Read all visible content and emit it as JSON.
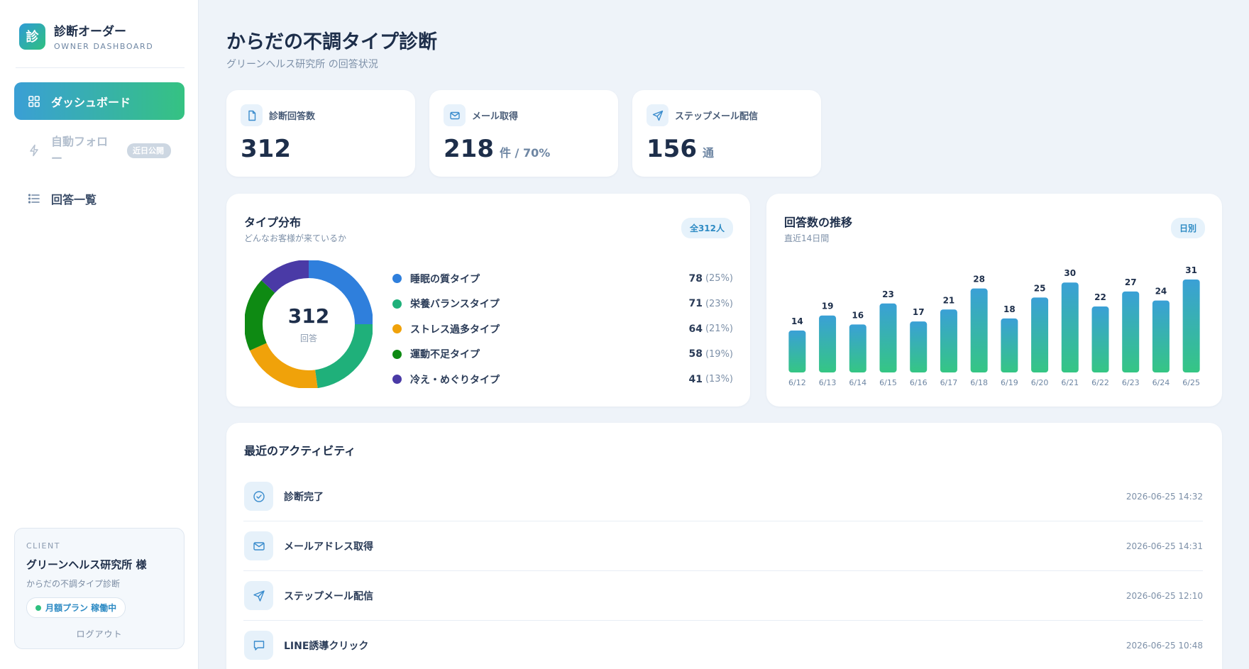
{
  "sidebar": {
    "logo_char": "診",
    "brand_title": "診断オーダー",
    "brand_sub": "OWNER DASHBOARD",
    "nav": [
      {
        "label": "ダッシュボード",
        "icon": "grid-icon",
        "state": "active"
      },
      {
        "label": "自動フォロー",
        "icon": "lightning-icon",
        "state": "disabled",
        "badge": "近日公開"
      },
      {
        "label": "回答一覧",
        "icon": "list-icon",
        "state": "default"
      }
    ],
    "client": {
      "kicker": "CLIENT",
      "name": "グリーンヘルス研究所 様",
      "diagnosis": "からだの不調タイプ診断",
      "plan": "月額プラン 稼働中",
      "logout": "ログアウト"
    }
  },
  "header": {
    "title": "からだの不調タイプ診断",
    "subtitle": "グリーンヘルス研究所 の回答状況"
  },
  "kpis": [
    {
      "icon": "document-icon",
      "label": "診断回答数",
      "value": "312",
      "unit": ""
    },
    {
      "icon": "mail-icon",
      "label": "メール取得",
      "value": "218",
      "unit": "件 / 70%"
    },
    {
      "icon": "send-icon",
      "label": "ステップメール配信",
      "value": "156",
      "unit": "通"
    }
  ],
  "type_panel": {
    "title": "タイプ分布",
    "subtitle": "どんなお客様が来ているか",
    "pill": "全312人",
    "total": "312",
    "total_caption": "回答",
    "items": [
      {
        "name": "睡眠の質タイプ",
        "count": "78",
        "pct": "(25%)",
        "value": 78,
        "color": "#2f7fdc"
      },
      {
        "name": "栄養バランスタイプ",
        "count": "71",
        "pct": "(23%)",
        "value": 71,
        "color": "#1fb07a"
      },
      {
        "name": "ストレス過多タイプ",
        "count": "64",
        "pct": "(21%)",
        "value": 64,
        "color": "#f0a20a"
      },
      {
        "name": "運動不足タイプ",
        "count": "58",
        "pct": "(19%)",
        "value": 58,
        "color": "#0e8a13"
      },
      {
        "name": "冷え・めぐりタイプ",
        "count": "41",
        "pct": "(13%)",
        "value": 41,
        "color": "#4a3aa6"
      }
    ]
  },
  "chart_data": {
    "type": "bar",
    "title": "回答数の推移",
    "subtitle": "直近14日間",
    "toggle": "日別",
    "categories": [
      "6/12",
      "6/13",
      "6/14",
      "6/15",
      "6/16",
      "6/17",
      "6/18",
      "6/19",
      "6/20",
      "6/21",
      "6/22",
      "6/23",
      "6/24",
      "6/25"
    ],
    "values": [
      14,
      19,
      16,
      23,
      17,
      21,
      28,
      18,
      25,
      30,
      22,
      27,
      24,
      31
    ],
    "colors": {
      "top": "#3aa0d6",
      "bottom": "#35c684"
    }
  },
  "activity": {
    "title": "最近のアクティビティ",
    "items": [
      {
        "icon": "check-circle-icon",
        "label": "診断完了",
        "time": "2026-06-25 14:32"
      },
      {
        "icon": "mail-icon",
        "label": "メールアドレス取得",
        "time": "2026-06-25 14:31"
      },
      {
        "icon": "send-icon",
        "label": "ステップメール配信",
        "time": "2026-06-25 12:10"
      },
      {
        "icon": "chat-icon",
        "label": "LINE誘導クリック",
        "time": "2026-06-25 10:48"
      }
    ]
  }
}
